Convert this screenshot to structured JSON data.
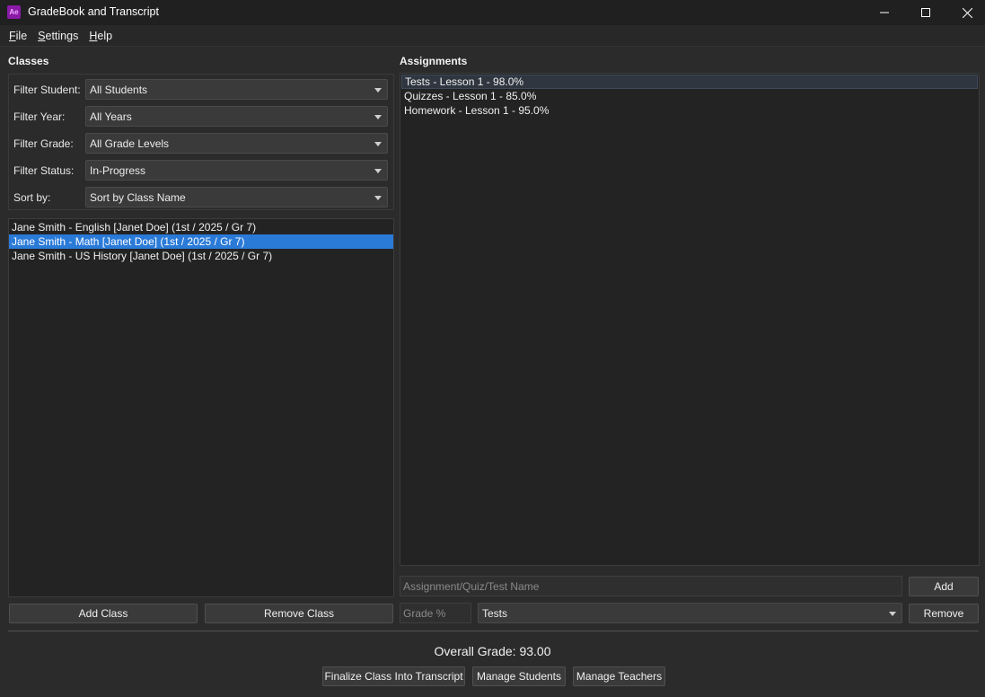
{
  "window": {
    "title": "GradeBook and Transcript",
    "icon_text": "Ae",
    "icons": {
      "app": "app-icon",
      "minimize": "minimize-icon",
      "maximize": "maximize-icon",
      "close": "close-icon"
    }
  },
  "menu": {
    "file": {
      "first": "F",
      "rest": "ile"
    },
    "settings": {
      "first": "S",
      "rest": "ettings"
    },
    "help": {
      "first": "H",
      "rest": "elp"
    }
  },
  "classes": {
    "heading": "Classes",
    "filters": {
      "student": {
        "label": "Filter Student:",
        "value": "All Students"
      },
      "year": {
        "label": "Filter Year:",
        "value": "All Years"
      },
      "grade": {
        "label": "Filter Grade:",
        "value": "All Grade Levels"
      },
      "status": {
        "label": "Filter Status:",
        "value": "In-Progress"
      },
      "sort": {
        "label": "Sort by:",
        "value": "Sort by Class Name"
      }
    },
    "items": [
      "Jane Smith - English [Janet Doe] (1st / 2025 / Gr 7)",
      "Jane Smith - Math [Janet Doe] (1st / 2025 / Gr 7)",
      "Jane Smith - US History [Janet Doe] (1st / 2025 / Gr 7)"
    ],
    "selected_index": 1,
    "add_label": "Add Class",
    "remove_label": "Remove Class"
  },
  "assignments": {
    "heading": "Assignments",
    "items": [
      "Tests - Lesson 1 - 98.0%",
      "Quizzes - Lesson 1 - 85.0%",
      "Homework - Lesson 1 - 95.0%"
    ],
    "name_placeholder": "Assignment/Quiz/Test Name",
    "grade_placeholder": "Grade %",
    "category_value": "Tests",
    "add_label": "Add",
    "remove_label": "Remove"
  },
  "footer": {
    "overall_grade": "Overall Grade: 93.00",
    "finalize_label": "Finalize Class Into Transcript",
    "manage_students_label": "Manage Students",
    "manage_teachers_label": "Manage Teachers"
  }
}
